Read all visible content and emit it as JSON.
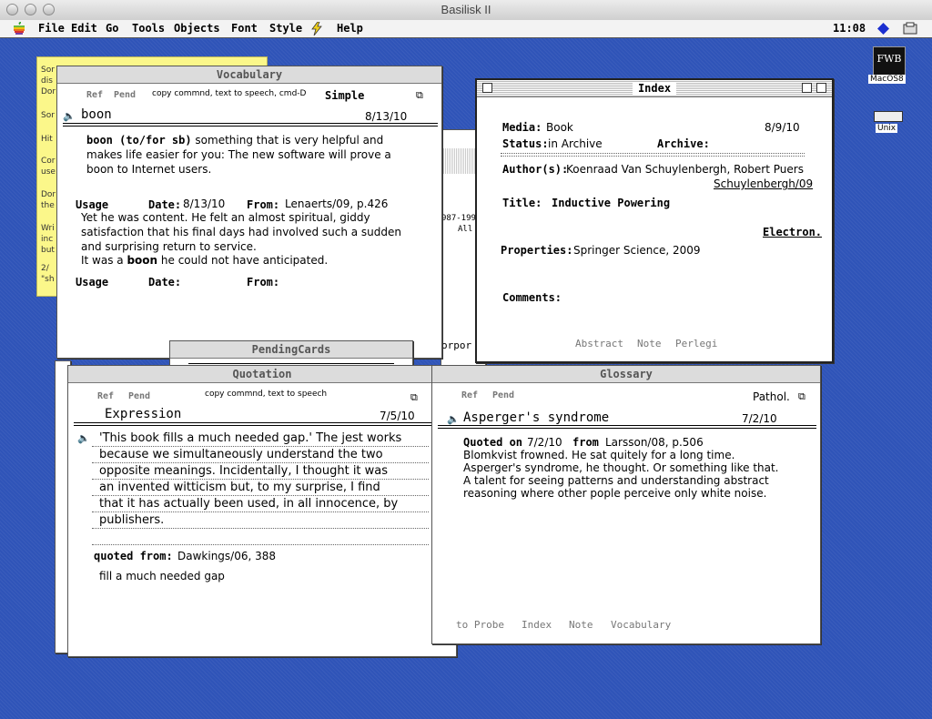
{
  "app": {
    "title": "Basilisk II",
    "clock": "11:08"
  },
  "menu": [
    "File",
    "Edit",
    "Go",
    "Tools",
    "Objects",
    "Font",
    "Style",
    "Help"
  ],
  "icons": {
    "macos": "MacOS8",
    "unix": "Unix",
    "fwb": "FWB"
  },
  "sticky": [
    "Sor",
    "dis",
    "Dor",
    "Sor",
    "Hit",
    "Cor",
    "use",
    "Dor",
    "the",
    "Wri",
    "inc",
    "but",
    "2/",
    "\"sh"
  ],
  "vocab": {
    "title": "Vocabulary",
    "tabs": {
      "ref": "Ref",
      "pend": "Pend"
    },
    "hint": "copy commnd, text to speech, cmd-D",
    "kind": "Simple",
    "word": "boon",
    "date": "8/13/10",
    "def_term": "boon (to/for sb)",
    "def_lines": [
      "something that is very helpful and",
      "makes life easier for you: The new software will prove a",
      "boon to Internet users."
    ],
    "usage_label": "Usage",
    "date_label": "Date:",
    "from_label": "From:",
    "usage_date": "8/13/10",
    "usage_from": "Lenaerts/09, p.426",
    "quote_lines": [
      "Yet he was content.  He felt an almost spiritual, giddy",
      "satisfaction that his final days had involved such a sudden",
      "and surprising return to service."
    ],
    "last_pre": "It was a ",
    "last_bold": "boon",
    "last_post": " he could not have anticipated."
  },
  "behind": {
    "years": "987-199",
    "all": "All R",
    "corp": "orpor"
  },
  "index": {
    "title": "Index",
    "media_label": "Media:",
    "media": "Book",
    "date": "8/9/10",
    "status_label": "Status:",
    "status": "in Archive",
    "archive_label": "Archive:",
    "authors_label": "Author(s):",
    "authors": "Koenraad Van Schuylenbergh, Robert Puers",
    "ref": "Schuylenbergh/09",
    "title_label": "Title:",
    "work_title": "Inductive Powering",
    "subject": "Electron.",
    "properties_label": "Properties:",
    "properties": "Springer Science, 2009",
    "comments_label": "Comments:",
    "buttons": [
      "Abstract",
      "Note",
      "Perlegi"
    ]
  },
  "pending": {
    "title": "PendingCards"
  },
  "quotation": {
    "title": "Quotation",
    "tabs": {
      "ref": "Ref",
      "pend": "Pend"
    },
    "hint": "copy commnd, text to speech",
    "heading": "Expression",
    "date": "7/5/10",
    "lines": [
      "'This book fills a much needed gap.' The jest works",
      "because we simultaneously understand the two",
      "opposite meanings.  Incidentally, I thought it was",
      "an invented witticism but, to my surprise,  I find",
      "that it has actually been used, in all innocence, by",
      "publishers."
    ],
    "quoted_label": "quoted from:",
    "quoted": "Dawkings/06, 388",
    "note": "fill a much needed gap"
  },
  "glossary": {
    "title": "Glossary",
    "tabs": {
      "ref": "Ref",
      "pend": "Pend"
    },
    "kind": "Pathol.",
    "term": "Asperger's syndrome",
    "date": "7/2/10",
    "quoted_label": "Quoted on",
    "quoted_date": "7/2/10",
    "from_label": "from",
    "source": "Larsson/08, p.506",
    "lines": [
      "Blomkvist frowned.  He sat quitely for a long time.",
      "Asperger's syndrome, he thought.  Or something like that.",
      "A talent for seeing patterns and understanding abstract",
      "reasoning where other pople perceive only white noise."
    ],
    "buttons": [
      "to Probe",
      "Index",
      "Note",
      "Vocabulary"
    ]
  }
}
